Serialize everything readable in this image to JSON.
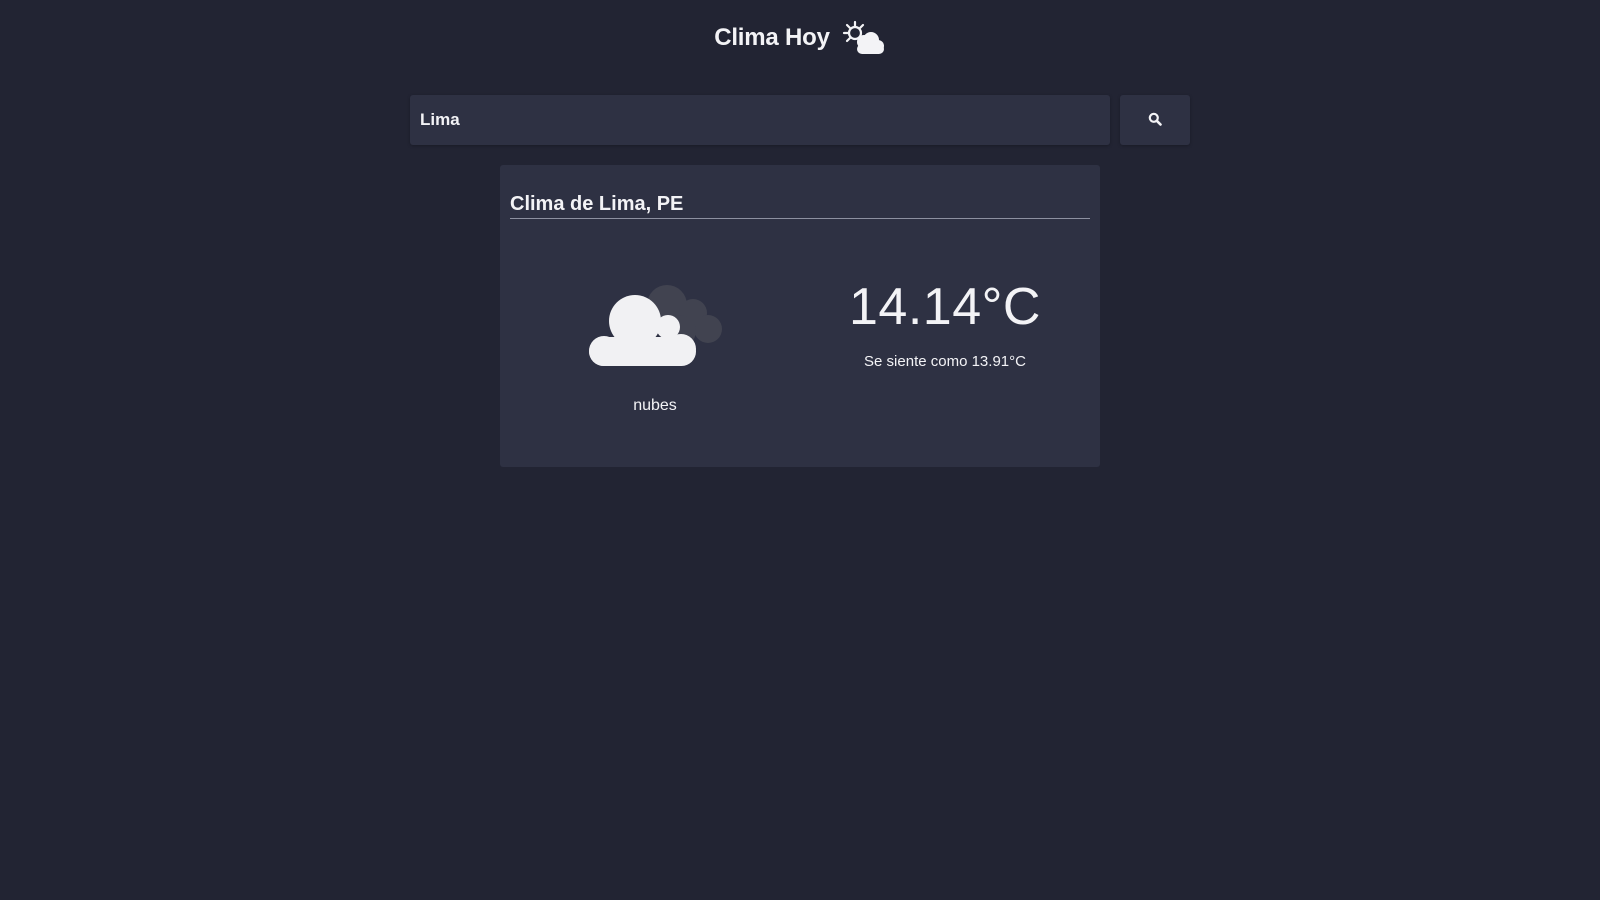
{
  "header": {
    "title": "Clima Hoy",
    "icon": "sun-behind-cloud-icon"
  },
  "search": {
    "value": "Lima",
    "placeholder": "",
    "button_icon": "search-icon"
  },
  "weather": {
    "title": "Clima de Lima, PE",
    "condition_icon": "cloud-icon",
    "condition": "nubes",
    "temperature": "14.14°C",
    "feels_like_label": "Se siente como",
    "feels_like_value": "13.91°C"
  },
  "colors": {
    "background": "#222433",
    "surface": "#2e3143",
    "text": "#f3f3f6",
    "divider": "#8d90a0"
  }
}
